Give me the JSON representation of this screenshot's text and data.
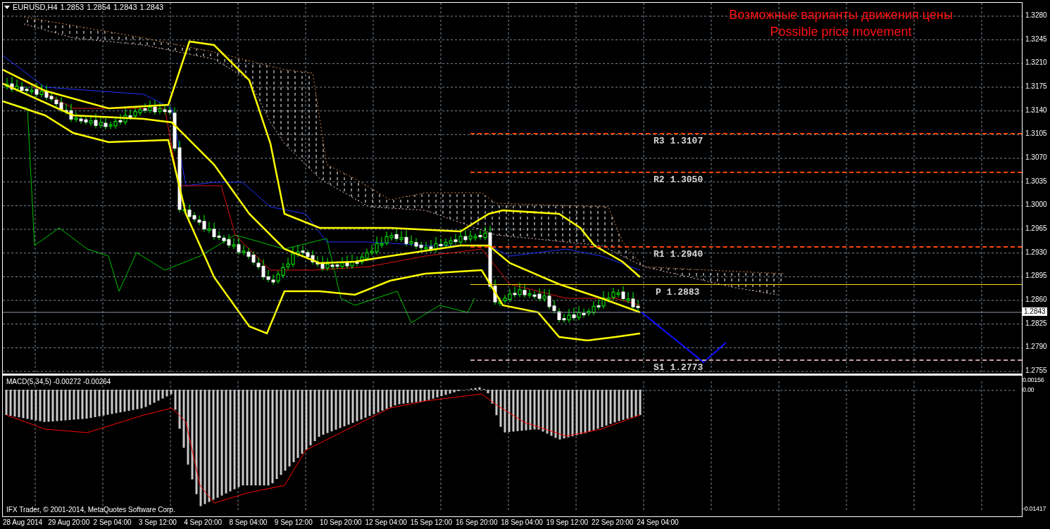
{
  "chart": {
    "title": "EURUSD,H4",
    "ohlc": [
      "1.2853",
      "1.2854",
      "1.2843",
      "1.2843"
    ],
    "annotation": [
      "Возможные варианты движения цены",
      "Possible price movement"
    ],
    "levels": [
      {
        "label": "R3 1.3107",
        "color": "#ff4500",
        "kind": "dashed"
      },
      {
        "label": "R2 1.3050",
        "color": "#ff4500",
        "kind": "dashed"
      },
      {
        "label": "R1 1.2940",
        "color": "#ff4500",
        "kind": "dashed"
      },
      {
        "label": "P 1.2883",
        "color": "#ffd700",
        "kind": "solid"
      },
      {
        "label": "S1 1.2773",
        "color": "#c8a0a0",
        "kind": "dashed"
      }
    ],
    "price_axis": [
      "1.3280",
      "1.3245",
      "1.3210",
      "1.3175",
      "1.3140",
      "1.3105",
      "1.3070",
      "1.3035",
      "1.3000",
      "1.2965",
      "1.2930",
      "1.2895",
      "1.2860",
      "1.2825",
      "1.2790",
      "1.2755"
    ],
    "current_price": "1.2843"
  },
  "macd": {
    "label": "MACD(5,34,5) -0.00272 -0.00264",
    "axis": [
      "0.00156",
      "0.00",
      "-0.01417"
    ]
  },
  "copyright": "IFX Trader, © 2001-2014, MetaQuotes Software Corp.",
  "time_axis": [
    "28 Aug 2014",
    "29 Aug 20:00",
    "2 Sep 04:00",
    "3 Sep 12:00",
    "4 Sep 20:00",
    "8 Sep 04:00",
    "9 Sep 12:00",
    "10 Sep 20:00",
    "12 Sep 04:00",
    "15 Sep 12:00",
    "16 Sep 20:00",
    "18 Sep 04:00",
    "19 Sep 12:00",
    "22 Sep 20:00",
    "24 Sep 04:00"
  ]
}
